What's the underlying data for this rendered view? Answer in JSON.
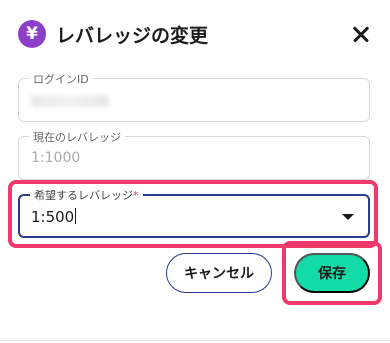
{
  "header": {
    "icon": "yen-icon",
    "icon_glyph": "¥",
    "title": "レバレッジの変更"
  },
  "fields": {
    "login_id": {
      "label": "ログインID",
      "value": ""
    },
    "current_leverage": {
      "label": "現在のレバレッジ",
      "value": "1:1000"
    },
    "desired_leverage": {
      "label": "希望するレバレッジ",
      "required_mark": "*",
      "value": "1:500"
    }
  },
  "buttons": {
    "cancel": "キャンセル",
    "save": "保存"
  },
  "colors": {
    "accent_purple": "#8b3fc9",
    "save_green": "#12dba8",
    "highlight_pink": "#f0386b",
    "focus_navy": "#2a3a8f"
  }
}
